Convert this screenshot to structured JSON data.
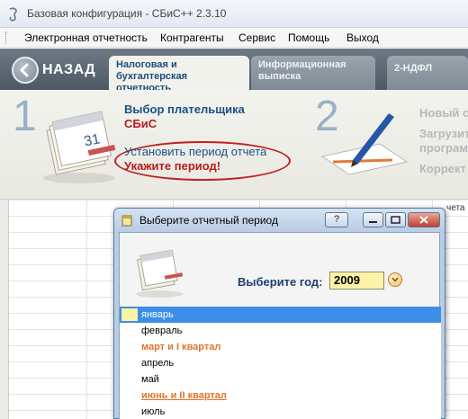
{
  "window": {
    "title": "Базовая конфигурация - СБиС++ 2.3.10",
    "icon": "sbis-app-icon"
  },
  "menu": [
    "Электронная отчетность",
    "Контрагенты",
    "Сервис",
    "Помощь",
    "Выход"
  ],
  "header": {
    "back_label": "НАЗАД",
    "tabs": [
      {
        "label_line1": "Налоговая и",
        "label_line2": "бухгалтерская отчетность",
        "active": true
      },
      {
        "label_line1": "Информационная",
        "label_line2": "выписка",
        "active": false
      },
      {
        "label_line1": "2-НДФЛ",
        "label_line2": "",
        "active": false
      }
    ]
  },
  "wizard": {
    "step1": {
      "number": "1",
      "title": "Выбор плательщика",
      "value": "СБиС",
      "period_link": "Установить период отчета",
      "period_hint": "Укажите период!"
    },
    "step2": {
      "number": "2",
      "items": [
        "Новый о",
        "Загрузит",
        "програм",
        "Коррект"
      ]
    }
  },
  "grid": {
    "col_hint": "чета"
  },
  "dialog": {
    "title": "Выберите отчетный период",
    "help_btn": "?",
    "year_label": "Выберите год:",
    "year_value": "2009",
    "months": [
      {
        "label": "январь",
        "kind": "month",
        "selected": true
      },
      {
        "label": "февраль",
        "kind": "month",
        "selected": false
      },
      {
        "label": "март и I квартал",
        "kind": "quarter",
        "selected": false
      },
      {
        "label": "апрель",
        "kind": "month",
        "selected": false
      },
      {
        "label": "май",
        "kind": "month",
        "selected": false
      },
      {
        "label": "июнь и II квартал",
        "kind": "halfyear",
        "selected": false
      },
      {
        "label": "июль",
        "kind": "month",
        "selected": false
      }
    ]
  },
  "colors": {
    "accent_blue": "#1b4f86",
    "accent_red": "#b81c1c",
    "quarter_orange": "#e0752a",
    "selection_blue": "#3d8ee8",
    "year_field": "#fdf3a6"
  }
}
